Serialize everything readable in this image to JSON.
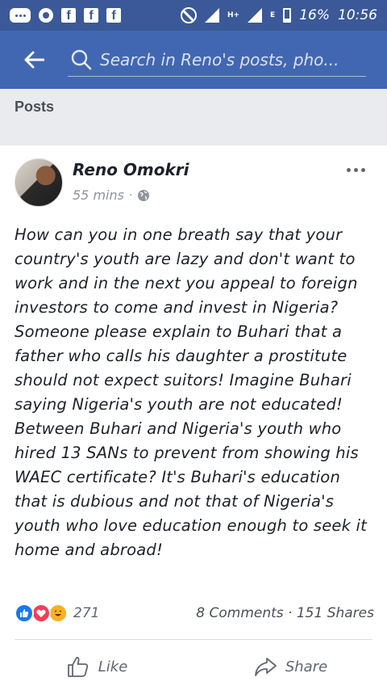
{
  "status_bar": {
    "battery": "16%",
    "time": "10:56",
    "network_labels": [
      "H+",
      "E"
    ]
  },
  "header": {
    "back_icon": "back-arrow-icon",
    "search_icon": "search-icon",
    "search_placeholder": "Search in Reno's posts, pho..."
  },
  "section": {
    "title": "Posts"
  },
  "post": {
    "author": "Reno Omokri",
    "time": "55 mins",
    "separator": "·",
    "privacy_icon": "globe-icon",
    "more_icon": "more-options-icon",
    "text": "How can you in one breath say that your country's youth are lazy and don't want to work and in the next you appeal to foreign investors to come and invest in Nigeria? Someone please explain to Buhari that a father who calls his daughter a prostitute should not expect suitors! Imagine Buhari saying Nigeria's youth are not educated! Between Buhari and Nigeria's youth who hired 13 SANs to prevent from showing his WAEC certificate? It's Buhari's education that is dubious and not that of Nigeria's youth who love education enough to seek it home and abroad!",
    "reactions": {
      "icons": [
        "like-reaction-icon",
        "love-reaction-icon",
        "haha-reaction-icon"
      ],
      "count": "271"
    },
    "comments": "8 Comments",
    "dot": "·",
    "shares": "151 Shares",
    "actions": {
      "like": "Like",
      "share": "Share"
    }
  },
  "colors": {
    "status_bar": "#3b5998",
    "header": "#4267b2",
    "section_bg": "#e9ebee",
    "text": "#1d2129",
    "muted": "#606770"
  }
}
